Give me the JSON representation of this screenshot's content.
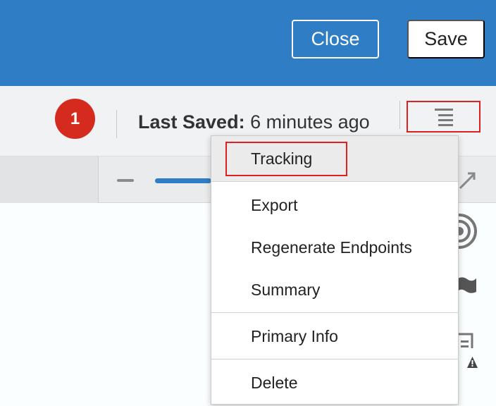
{
  "header": {
    "close_label": "Close",
    "save_label": "Save",
    "background": "#2f7dc4"
  },
  "status": {
    "badge_count": "1",
    "badge_color": "#d52b1e",
    "last_saved_label": "Last Saved:",
    "last_saved_value": "6 minutes ago"
  },
  "menu": {
    "icon": "hamburger-menu-icon",
    "items": [
      {
        "label": "Tracking",
        "highlighted": true
      },
      {
        "label": "Export"
      },
      {
        "label": "Regenerate Endpoints"
      },
      {
        "label": "Summary"
      },
      {
        "label": "Primary Info"
      },
      {
        "label": "Delete"
      }
    ]
  },
  "toolbar": {
    "zoom_out_icon": "minus-icon",
    "expand_icon": "expand-icon"
  },
  "side_icons": [
    "target-icon",
    "flag-icon",
    "warning-document-icon"
  ]
}
